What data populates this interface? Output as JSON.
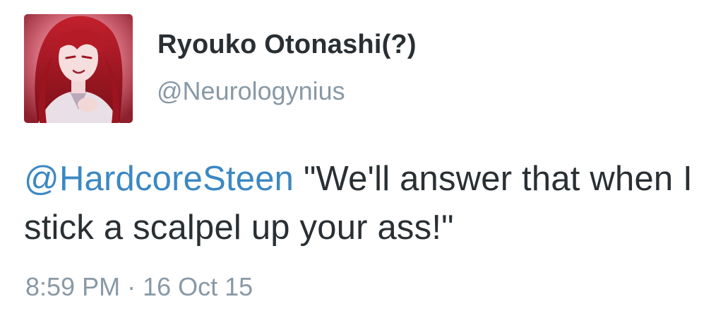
{
  "user": {
    "display_name": "Ryouko Otonashi(?)",
    "handle": "@Neurologynius",
    "avatar_icon": "avatar-image"
  },
  "tweet": {
    "mention": "@HardcoreSteen",
    "body": " \"We'll answer that when I stick a scalpel up your ass!\""
  },
  "meta": {
    "time": "8:59 PM",
    "separator": " · ",
    "date": "16 Oct 15"
  },
  "colors": {
    "text": "#292f33",
    "secondary": "#8899a6",
    "link": "#3b88c3"
  }
}
